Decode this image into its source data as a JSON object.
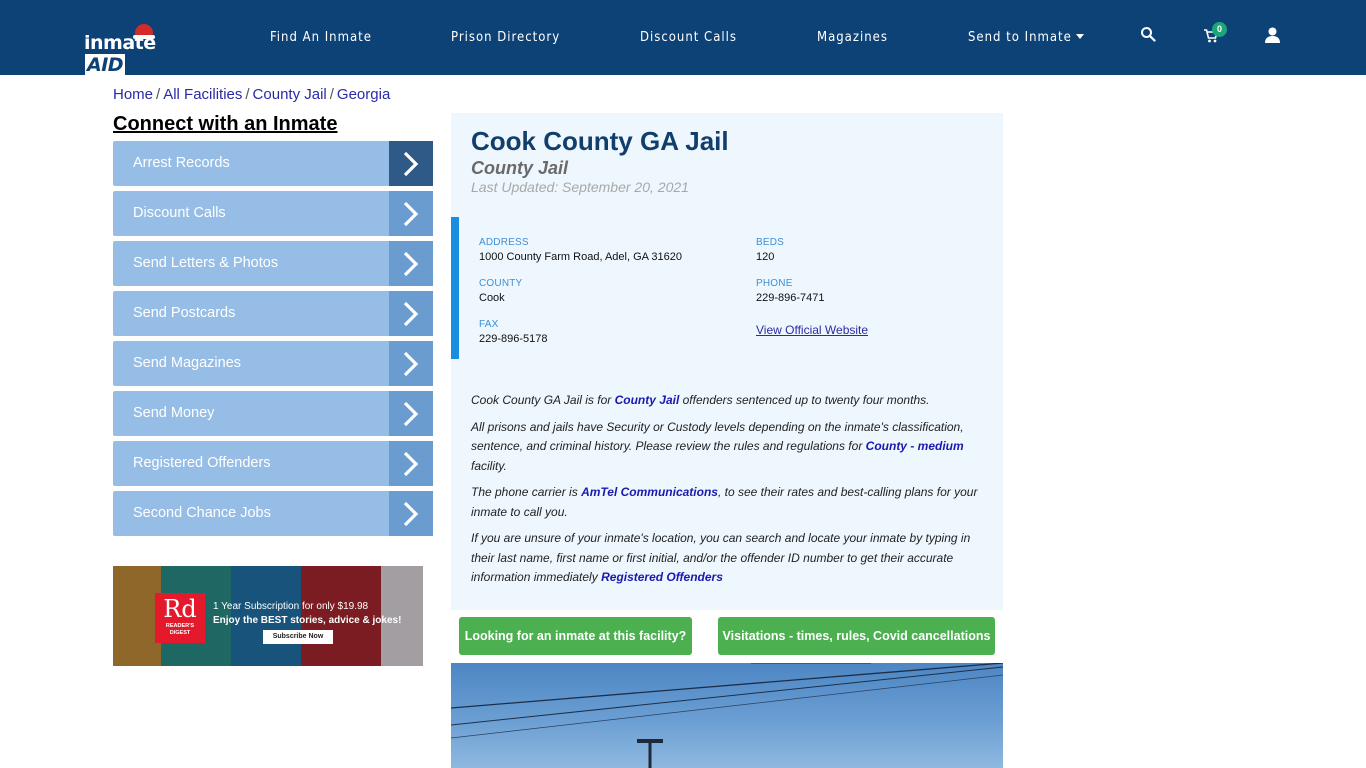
{
  "header": {
    "logo_text": "inmate",
    "logo_accent": "AID",
    "nav": [
      {
        "label": "Find An Inmate"
      },
      {
        "label": "Prison Directory"
      },
      {
        "label": "Discount Calls"
      },
      {
        "label": "Magazines"
      },
      {
        "label": "Send to Inmate",
        "dropdown": true
      }
    ],
    "icons": {
      "search": "search-icon",
      "cart": "cart-icon",
      "user": "user-icon"
    },
    "cart_count": "0"
  },
  "breadcrumb": [
    {
      "label": "Home"
    },
    {
      "label": "All Facilities"
    },
    {
      "label": "County Jail"
    },
    {
      "label": "Georgia"
    }
  ],
  "breadcrumb_sep": "/",
  "sidebar": {
    "title": "Connect with an Inmate",
    "items": [
      {
        "label": "Arrest Records"
      },
      {
        "label": "Discount Calls"
      },
      {
        "label": "Send Letters & Photos"
      },
      {
        "label": "Send Postcards"
      },
      {
        "label": "Send Magazines"
      },
      {
        "label": "Send Money"
      },
      {
        "label": "Registered Offenders"
      },
      {
        "label": "Second Chance Jobs"
      }
    ]
  },
  "ad": {
    "brand_short": "Rd",
    "brand_name": "READER'S DIGEST",
    "line1": "1 Year Subscription for only $19.98",
    "line2": "Enjoy the BEST stories, advice & jokes!",
    "cta": "Subscribe Now"
  },
  "facility": {
    "name": "Cook County GA Jail",
    "type": "County Jail",
    "last_updated": "Last Updated: September 20, 2021",
    "fields": {
      "address": {
        "label": "ADDRESS",
        "value": "1000 County Farm Road, Adel, GA 31620"
      },
      "beds": {
        "label": "BEDS",
        "value": "120"
      },
      "county": {
        "label": "COUNTY",
        "value": "Cook"
      },
      "phone": {
        "label": "PHONE",
        "value": "229-896-7471"
      },
      "fax": {
        "label": "FAX",
        "value": "229-896-5178"
      }
    },
    "website_link": "View Official Website"
  },
  "description": {
    "p1_a": "Cook County GA Jail is for ",
    "p1_link": "County Jail",
    "p1_b": " offenders sentenced up to twenty four months.",
    "p2_a": "All prisons and jails have Security or Custody levels depending on the inmate's classification, sentence, and criminal history. Please review the rules and regulations for ",
    "p2_link": "County - medium",
    "p2_b": " facility.",
    "p3_a": "The phone carrier is ",
    "p3_link": "AmTel Communications",
    "p3_b": ", to see their rates and best-calling plans for your inmate to call you.",
    "p4_a": "If you are unsure of your inmate's location, you can search and locate your inmate by typing in their last name, first name or first initial, and/or the offender ID number to get their accurate information immediately ",
    "p4_link": "Registered Offenders"
  },
  "buttons": {
    "find_inmate": "Looking for an inmate at this facility?",
    "visitations": "Visitations - times, rules, Covid cancellations"
  },
  "colors": {
    "nav_bg": "#0d4277",
    "sidebar_item": "#95bde6",
    "sidebar_arrow_active": "#2f5a87",
    "card_bg": "#eef7fd",
    "accent_blue": "#1a8de0",
    "green": "#4caf50"
  }
}
